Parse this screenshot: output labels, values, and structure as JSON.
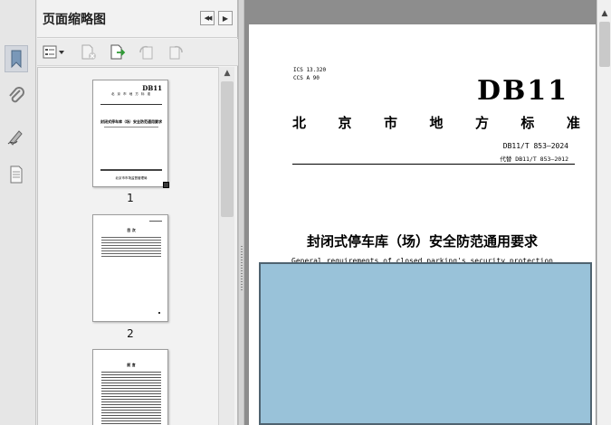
{
  "panel": {
    "title": "页面缩略图",
    "collapse_glyph": "◀◀",
    "expand_glyph": "▶"
  },
  "thumbnails": [
    {
      "page_number": "1",
      "mini": {
        "brand": "DB11",
        "stdline": "北 京 市 地 方 标 准",
        "title": "封闭式停车库（场）安全防范通用要求",
        "publisher": "北京市市场监督管理局"
      }
    },
    {
      "page_number": "2",
      "mini": {
        "heading": "目  次"
      }
    },
    {
      "page_number": "",
      "mini": {
        "heading": "前  言"
      }
    }
  ],
  "document": {
    "ics": "ICS 13.320",
    "ccs": "CCS A 90",
    "brand": "DB11",
    "std_chars": [
      "北",
      "京",
      "市",
      "地",
      "方",
      "标",
      "准"
    ],
    "std_number": "DB11/T 853—2024",
    "replaces": "代替 DB11/T 853—2012",
    "title_cn": "封闭式停车库（场）安全防范通用要求",
    "title_en": "General requirements of closed parking's security protection"
  },
  "colors": {
    "cover_box": "#99c2d9",
    "cover_box_border": "#4f6370"
  }
}
